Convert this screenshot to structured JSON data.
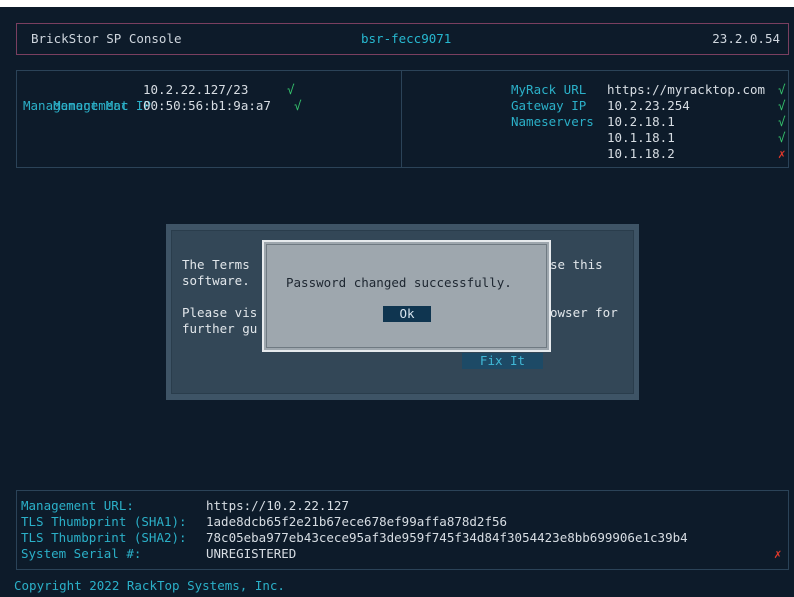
{
  "header": {
    "app_title": "BrickStor SP Console",
    "hostname": "bsr-fecc9071",
    "version": "23.2.0.54"
  },
  "network_left": {
    "rows": [
      {
        "label": "Management IP",
        "value": "10.2.22.127/23",
        "status": "√"
      },
      {
        "label": "Management Mac",
        "value": "00:50:56:b1:9a:a7",
        "status": "√"
      }
    ]
  },
  "network_right": {
    "myrack_label": "MyRack URL",
    "myrack_value": "https://myracktop.com",
    "myrack_status": "√",
    "gateway_label": "Gateway IP",
    "gateway_value": "10.2.23.254",
    "gateway_status": "√",
    "nameservers_label": "Nameservers",
    "nameservers": [
      {
        "value": "10.2.18.1",
        "status": "√"
      },
      {
        "value": "10.1.18.1",
        "status": "√"
      },
      {
        "value": "10.1.18.2",
        "status": "✗"
      }
    ]
  },
  "terms_dialog": {
    "line1_left": "The Terms",
    "line1_right": "se this",
    "line2_left": "software.",
    "line3_left": "Please vis",
    "line3_right": "owser for",
    "line4_left": "further gu",
    "fix_label": "Fix It"
  },
  "popup": {
    "message": "Password changed successfully.",
    "ok_label": "Ok"
  },
  "bottom": {
    "rows": [
      {
        "label": "Management URL:",
        "value": "https://10.2.22.127"
      },
      {
        "label": "TLS Thumbprint (SHA1):",
        "value": "1ade8dcb65f2e21b67ece678ef99affa878d2f56"
      },
      {
        "label": "TLS Thumbprint (SHA2):",
        "value": "78c05eba977eb43cece95af3de959f745f34d84f3054423e8bb699906e1c39b4"
      },
      {
        "label": "System Serial #:",
        "value": "UNREGISTERED"
      }
    ],
    "serial_status": "✗"
  },
  "footer": {
    "copyright": "Copyright 2022 RackTop Systems, Inc."
  },
  "colors": {
    "background": "#0d1b2a",
    "accent_cyan": "#2bb0c8",
    "ok_green": "#35c46d",
    "error_red": "#e0392b"
  }
}
